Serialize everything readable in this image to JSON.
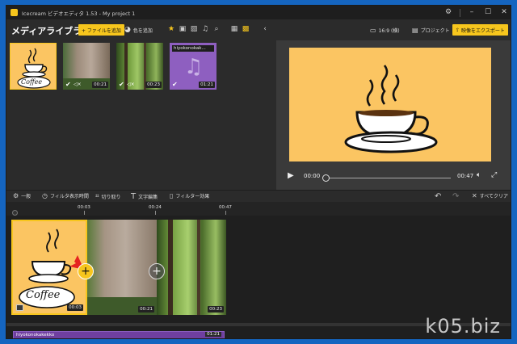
{
  "window": {
    "title": "Icecream ビデオエディタ 1.53 - My project 1"
  },
  "toolbar": {
    "library_title": "メディアライブラリ",
    "add_file_label": "+ ファイルを追加",
    "add_color_label": "色を追加",
    "aspect_label": "16:9 (横)",
    "project_label": "プロジェクト",
    "export_label": "映像をエクスポート"
  },
  "library": {
    "items": [
      {
        "kind": "image",
        "label": "Coffee"
      },
      {
        "kind": "video",
        "duration": "00:21"
      },
      {
        "kind": "video",
        "duration": "00:23"
      },
      {
        "kind": "audio",
        "name": "hiyokonokak...",
        "duration": "01:21"
      }
    ]
  },
  "preview": {
    "current_time": "00:00",
    "total_time": "00:47"
  },
  "edit_bar": {
    "general": "一般",
    "filter_duration": "フィルタ表示時間",
    "crop": "切り取り",
    "text_edit": "文字編集",
    "filter_effect": "フィルター効果",
    "clear_all": "すべてクリア"
  },
  "timeline": {
    "ticks": [
      "00:03",
      "00:24",
      "00:47"
    ],
    "clips": [
      {
        "label": "Coffee",
        "duration": "00:03"
      },
      {
        "duration": "00:21"
      },
      {
        "duration": "00:23"
      }
    ],
    "audio_name": "hiyokonokakekko",
    "audio_duration": "01:21"
  },
  "watermark": "k05.biz",
  "colors": {
    "accent": "#f7c61d",
    "bg": "#2b2b2b",
    "preview_bg": "#fbc562",
    "audio": "#6f3fa0"
  }
}
